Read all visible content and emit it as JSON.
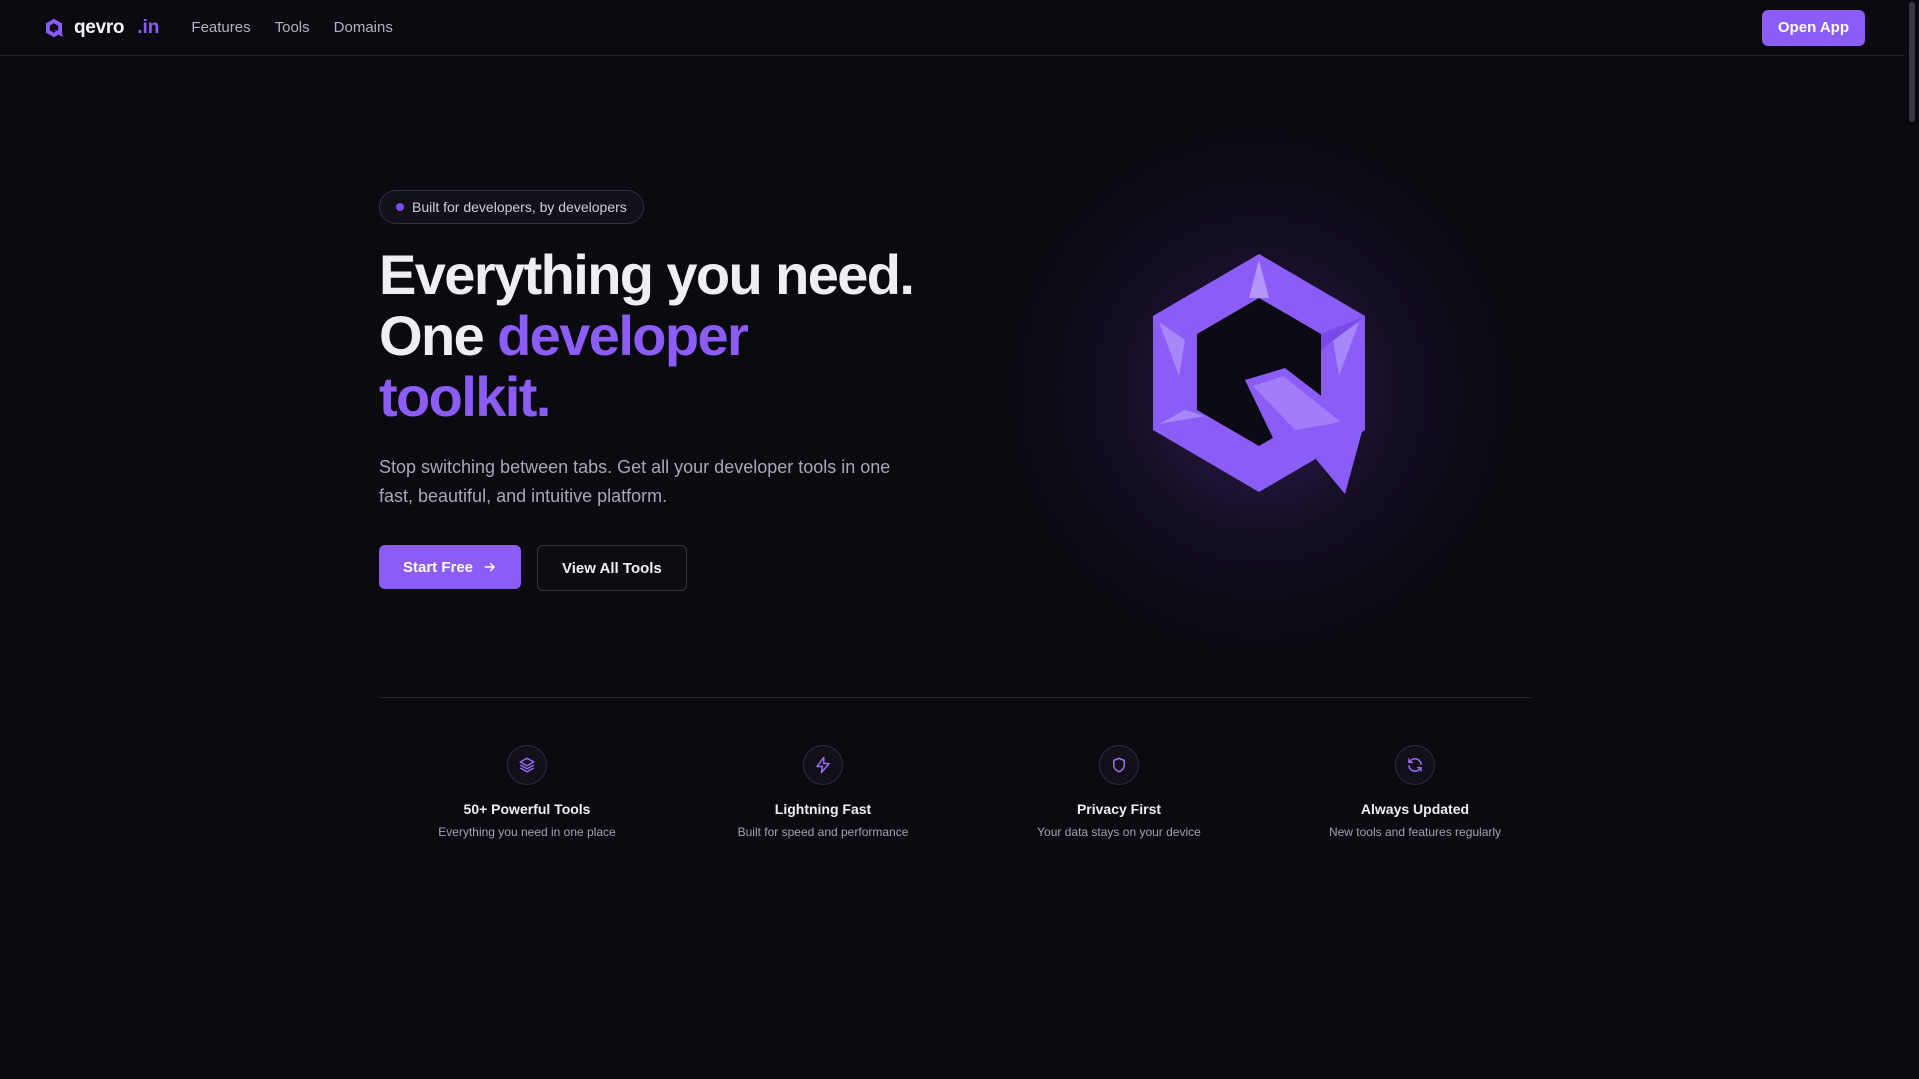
{
  "nav": {
    "brand_name": "qevro",
    "brand_tld": ".in",
    "links": [
      "Features",
      "Tools",
      "Domains"
    ],
    "open_app_label": "Open App"
  },
  "hero": {
    "badge": "Built for developers, by developers",
    "headline_line1": "Everything you need.",
    "headline_line2_plain": "One ",
    "headline_line2_accent": "developer",
    "headline_line3_accent": "toolkit.",
    "subtext": "Stop switching between tabs. Get all your developer tools in one fast, beautiful, and intuitive platform.",
    "start_label": "Start Free",
    "view_label": "View All Tools"
  },
  "features": [
    {
      "icon": "layers-icon",
      "title": "50+ Powerful Tools",
      "desc": "Everything you need in one place"
    },
    {
      "icon": "lightning-icon",
      "title": "Lightning Fast",
      "desc": "Built for speed and performance"
    },
    {
      "icon": "shield-icon",
      "title": "Privacy First",
      "desc": "Your data stays on your device"
    },
    {
      "icon": "refresh-icon",
      "title": "Always Updated",
      "desc": "New tools and features regularly"
    }
  ],
  "colors": {
    "accent": "#8b5cf6",
    "background": "#0b0a10"
  }
}
